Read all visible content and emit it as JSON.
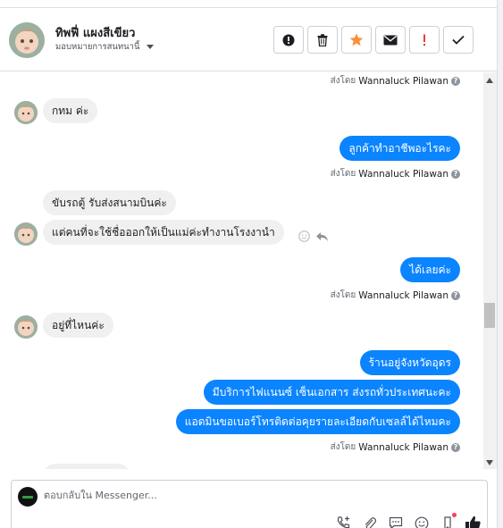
{
  "header": {
    "contact_name": "ทิพฟี่ แผงสีเขียว",
    "assign_label": "มอบหมายการสนทนานี้",
    "action_buttons": [
      {
        "name": "alert-icon"
      },
      {
        "name": "trash-icon"
      },
      {
        "name": "star-icon"
      },
      {
        "name": "envelope-icon"
      },
      {
        "name": "exclamation-icon"
      },
      {
        "name": "checkmark-icon"
      }
    ]
  },
  "conversation": {
    "sent_by_prefix": "ส่งโดย",
    "sender_name": "Wannaluck Pilawan",
    "help_glyph": "?",
    "messages": [
      {
        "dir": "out-meta"
      },
      {
        "dir": "in",
        "text": "กทม ค่ะ"
      },
      {
        "dir": "out",
        "text": "ลูกค้าทำอาชีพอะไรคะ"
      },
      {
        "dir": "in",
        "text": "ขับรถตู้ รับส่งสนามบินค่ะ"
      },
      {
        "dir": "in",
        "text": "แต่คนที่จะใช้ชื่อออกให้เป็นแม่ค่ะทำงานโรงงานำ"
      },
      {
        "dir": "out",
        "text": "ได้เลยค่ะ"
      },
      {
        "dir": "in",
        "text": "อยู่ที่ไหนค่ะ"
      },
      {
        "dir": "out",
        "text": "ร้านอยู่จังหวัดอุดร"
      },
      {
        "dir": "out",
        "text": "มีบริการไฟแนนซ์ เซ็นเอกสาร ส่งรถทั่วประเทศนะคะ"
      },
      {
        "dir": "out",
        "text": "แอดมินขอเบอร์โทรติดต่อคุยรายละเอียดกับเซลล์ได้ไหมคะ"
      }
    ]
  },
  "reply": {
    "placeholder": "ตอบกลับใน Messenger..."
  },
  "colors": {
    "accent": "#0b84ff",
    "incoming_bubble": "#f0f0f0",
    "star": "#f7923a",
    "exclamation": "#e2412c"
  }
}
